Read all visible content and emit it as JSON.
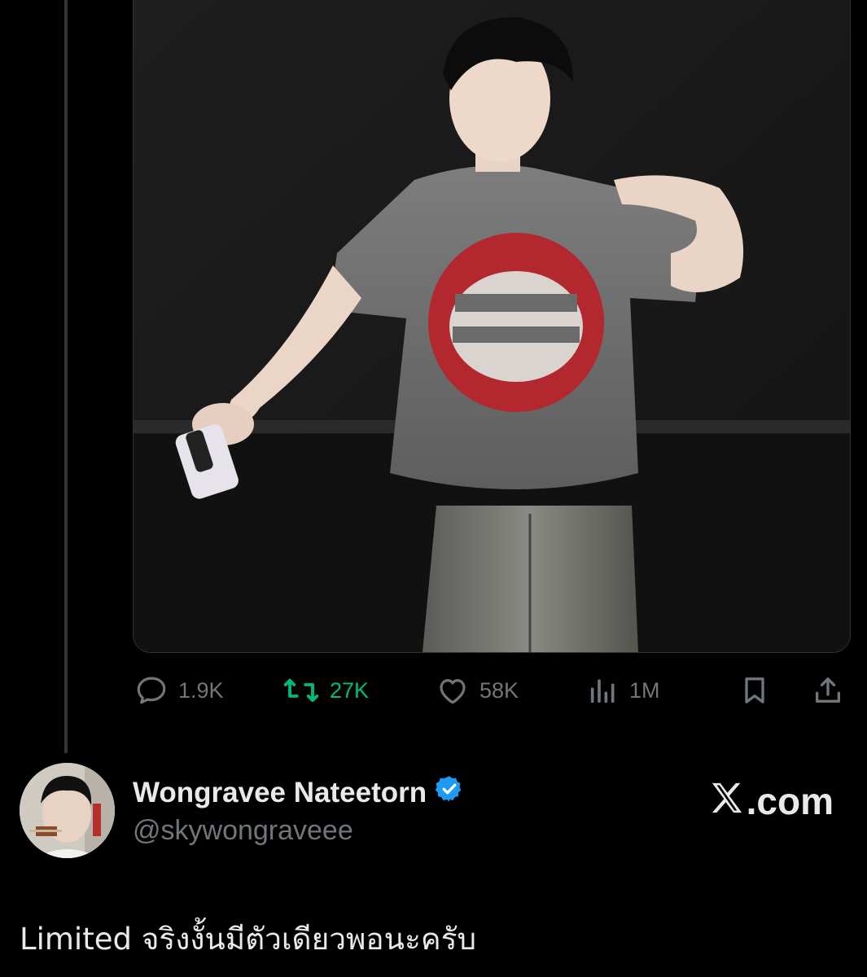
{
  "post": {
    "actions": {
      "replies": "1.9K",
      "retweets": "27K",
      "likes": "58K",
      "views": "1M"
    },
    "author": {
      "display_name": "Wongravee Nateetorn",
      "handle": "@skywongraveee",
      "verified": true
    },
    "text": "Limited จริงงั้นมีตัวเดียวพอนะครับ"
  },
  "brand": {
    "label": ".com"
  },
  "colors": {
    "background": "#000000",
    "text_primary": "#e7e9ea",
    "text_secondary": "#71767b",
    "retweet_active": "#00ba7c",
    "verified_badge": "#1d9bf0"
  },
  "icons": {
    "reply": "reply-icon",
    "retweet": "retweet-icon",
    "like": "heart-icon",
    "views": "views-icon",
    "bookmark": "bookmark-icon",
    "share": "share-icon",
    "verified": "verified-badge-icon",
    "x_logo": "x-logo-icon"
  }
}
